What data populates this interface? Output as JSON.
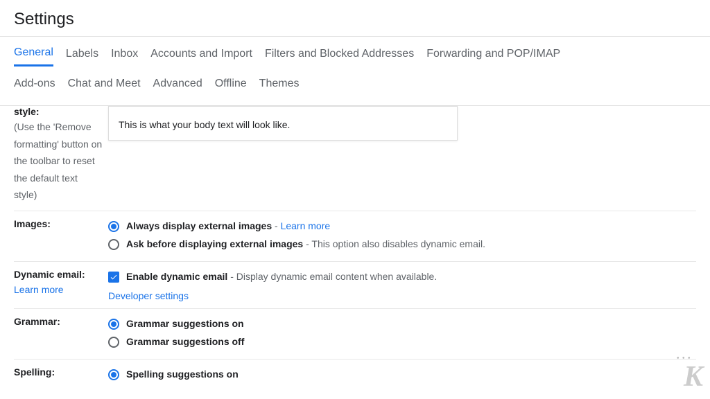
{
  "title": "Settings",
  "tabs_row1": [
    "General",
    "Labels",
    "Inbox",
    "Accounts and Import",
    "Filters and Blocked Addresses",
    "Forwarding and POP/IMAP"
  ],
  "tabs_row2": [
    "Add-ons",
    "Chat and Meet",
    "Advanced",
    "Offline",
    "Themes"
  ],
  "active_tab": "General",
  "style": {
    "label": "style:",
    "hint": "(Use the 'Remove formatting' button on the toolbar to reset the default text style)",
    "preview": "This is what your body text will look like."
  },
  "images": {
    "label": "Images:",
    "opt1": "Always display external images",
    "opt1_learn": "Learn more",
    "opt2": "Ask before displaying external images",
    "opt2_desc": "This option also disables dynamic email."
  },
  "dynamic": {
    "label": "Dynamic email:",
    "learn": "Learn more",
    "opt": "Enable dynamic email",
    "desc": "Display dynamic email content when available.",
    "dev": "Developer settings"
  },
  "grammar": {
    "label": "Grammar:",
    "on": "Grammar suggestions on",
    "off": "Grammar suggestions off"
  },
  "spelling": {
    "label": "Spelling:",
    "on": "Spelling suggestions on"
  }
}
